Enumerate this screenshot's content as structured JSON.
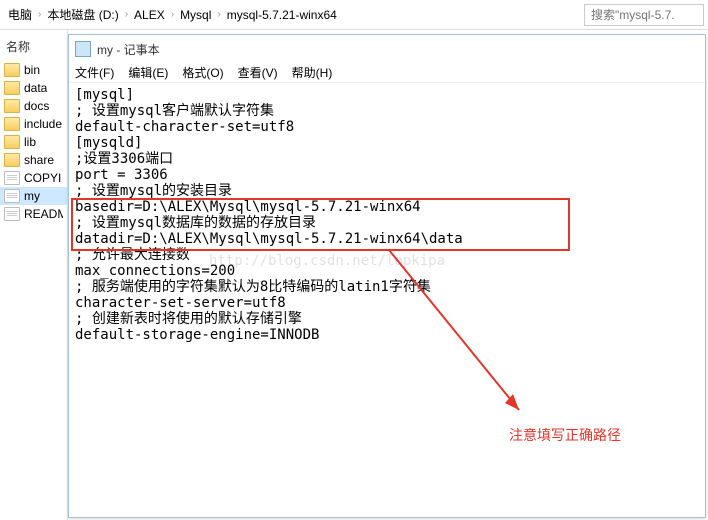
{
  "breadcrumb": {
    "items": [
      "电脑",
      "本地磁盘 (D:)",
      "ALEX",
      "Mysql",
      "mysql-5.7.21-winx64"
    ]
  },
  "search": {
    "placeholder": "搜索\"mysql-5.7."
  },
  "sidebar": {
    "header": "名称",
    "items": [
      {
        "type": "folder",
        "label": "bin"
      },
      {
        "type": "folder",
        "label": "data"
      },
      {
        "type": "folder",
        "label": "docs"
      },
      {
        "type": "folder",
        "label": "include"
      },
      {
        "type": "folder",
        "label": "lib"
      },
      {
        "type": "folder",
        "label": "share"
      },
      {
        "type": "file",
        "label": "COPYI"
      },
      {
        "type": "file",
        "label": "my",
        "selected": true
      },
      {
        "type": "file",
        "label": "READM"
      }
    ]
  },
  "notepad": {
    "title": "my - 记事本",
    "menu": {
      "file": "文件(F)",
      "edit": "编辑(E)",
      "format": "格式(O)",
      "view": "查看(V)",
      "help": "帮助(H)"
    },
    "content": "[mysql]\n; 设置mysql客户端默认字符集\ndefault-character-set=utf8\n[mysqld]\n;设置3306端口\nport = 3306\n; 设置mysql的安装目录\nbasedir=D:\\ALEX\\Mysql\\mysql-5.7.21-winx64\n; 设置mysql数据库的数据的存放目录\ndatadir=D:\\ALEX\\Mysql\\mysql-5.7.21-winx64\\data\n; 允许最大连接数\nmax_connections=200\n; 服务端使用的字符集默认为8比特编码的latin1字符集\ncharacter-set-server=utf8\n; 创建新表时将使用的默认存储引擎\ndefault-storage-engine=INNODB"
  },
  "annotation": {
    "watermark": "http://blog.csdn.net/lopkipa",
    "note": "注意填写正确路径"
  }
}
